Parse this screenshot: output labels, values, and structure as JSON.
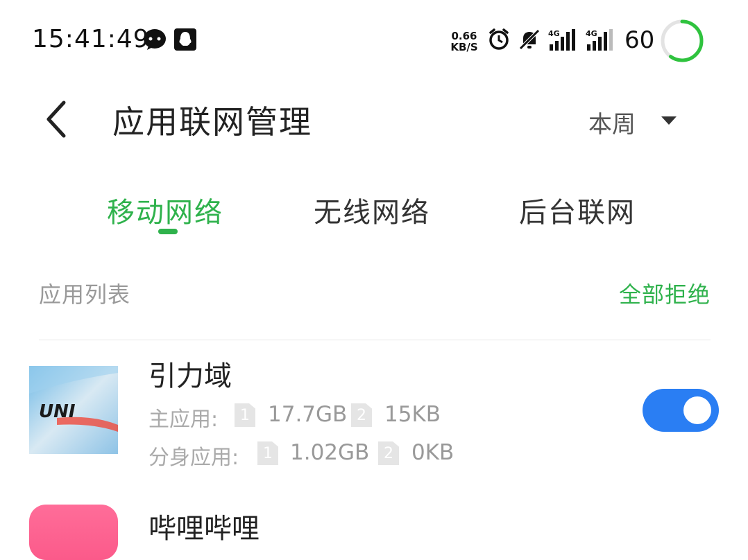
{
  "status_bar": {
    "time": "15:41:49",
    "net_speed_value": "0.66",
    "net_speed_unit": "KB/S",
    "signal1_label": "4G",
    "signal2_label": "4G",
    "battery": "60",
    "battery_level_percent": 60,
    "icons": [
      "wechat-icon",
      "qq-icon",
      "alarm-icon",
      "mute-icon",
      "signal-icon",
      "signal-icon"
    ]
  },
  "header": {
    "title": "应用联网管理",
    "period": "本周"
  },
  "tabs": [
    {
      "label": "移动网络",
      "active": true
    },
    {
      "label": "无线网络",
      "active": false
    },
    {
      "label": "后台联网",
      "active": false
    }
  ],
  "section": {
    "label": "应用列表",
    "action": "全部拒绝"
  },
  "apps": [
    {
      "name": "引力域",
      "icon_text": "UNI",
      "main_label": "主应用:",
      "main_sim1": "1",
      "main_sim1_usage": "17.7GB",
      "main_sim2": "2",
      "main_sim2_usage": "15KB",
      "clone_label": "分身应用:",
      "clone_sim1": "1",
      "clone_sim1_usage": "1.02GB",
      "clone_sim2": "2",
      "clone_sim2_usage": "0KB",
      "enabled": true
    },
    {
      "name": "哔哩哔哩"
    }
  ],
  "colors": {
    "accent_green": "#2fb24c",
    "toggle_blue": "#2a7ef3"
  }
}
